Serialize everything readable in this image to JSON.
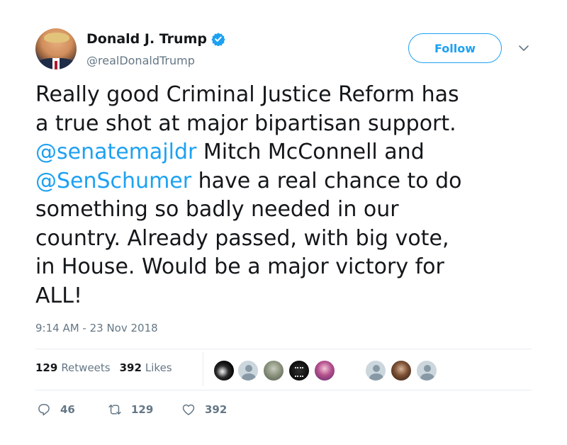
{
  "user": {
    "display_name": "Donald J. Trump",
    "handle": "@realDonaldTrump",
    "verified": true
  },
  "follow_label": "Follow",
  "tweet": {
    "lines": [
      [
        {
          "t": "Really good Criminal Justice Reform has"
        }
      ],
      [
        {
          "t": "a true shot at major bipartisan support."
        }
      ],
      [
        {
          "t": "@senatemajldr",
          "mention": true
        },
        {
          "t": " Mitch McConnell and"
        }
      ],
      [
        {
          "t": "@SenSchumer",
          "mention": true
        },
        {
          "t": " have a real chance to do"
        }
      ],
      [
        {
          "t": "something so badly needed in our"
        }
      ],
      [
        {
          "t": "country. Already passed, with big vote,"
        }
      ],
      [
        {
          "t": "in House. Would be a major victory for"
        }
      ],
      [
        {
          "t": "ALL!"
        }
      ]
    ],
    "timestamp": "9:14 AM - 23 Nov 2018"
  },
  "stats": {
    "retweets_count": "129",
    "retweets_label": "Retweets",
    "likes_count": "392",
    "likes_label": "Likes"
  },
  "likers": [
    {
      "style": "dark"
    },
    {
      "style": "default"
    },
    {
      "style": "photo"
    },
    {
      "style": "badge"
    },
    {
      "style": "anime"
    },
    {
      "style": "default"
    },
    {
      "style": "portrait"
    },
    {
      "style": "default"
    }
  ],
  "actions": {
    "reply_count": "46",
    "retweet_count": "129",
    "like_count": "392"
  },
  "icons": {
    "verified": "verified-badge-icon",
    "caret": "chevron-down-icon",
    "reply": "reply-icon",
    "retweet": "retweet-icon",
    "like": "heart-icon"
  },
  "colors": {
    "accent": "#1da1f2",
    "text": "#14171a",
    "muted": "#657786",
    "divider": "#e6ecf0"
  }
}
